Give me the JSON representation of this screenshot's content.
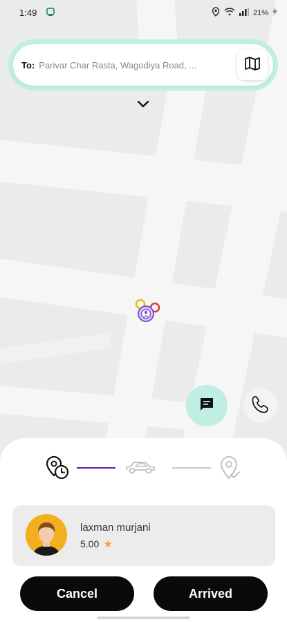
{
  "status_bar": {
    "time": "1:49",
    "battery": "21%"
  },
  "destination": {
    "prefix": "To:",
    "address": "Parivar Char Rasta, Wagodiya Road, ..."
  },
  "icons": {
    "map": "map-icon",
    "chevron": "chevron-down-icon",
    "chat": "chat-icon",
    "phone": "phone-icon",
    "marker": "location-marker-icon"
  },
  "progress": {
    "steps": [
      "clock-location",
      "car",
      "destination-pin"
    ],
    "active_color": "#5b1ab0",
    "inactive_color": "#c8c8c8"
  },
  "driver": {
    "name": "laxman murjani",
    "rating": "5.00",
    "star": "★"
  },
  "actions": {
    "cancel_label": "Cancel",
    "arrived_label": "Arrived"
  },
  "colors": {
    "accent": "#bfeee2",
    "button": "#0a0a0a",
    "star": "#f2a51e"
  }
}
